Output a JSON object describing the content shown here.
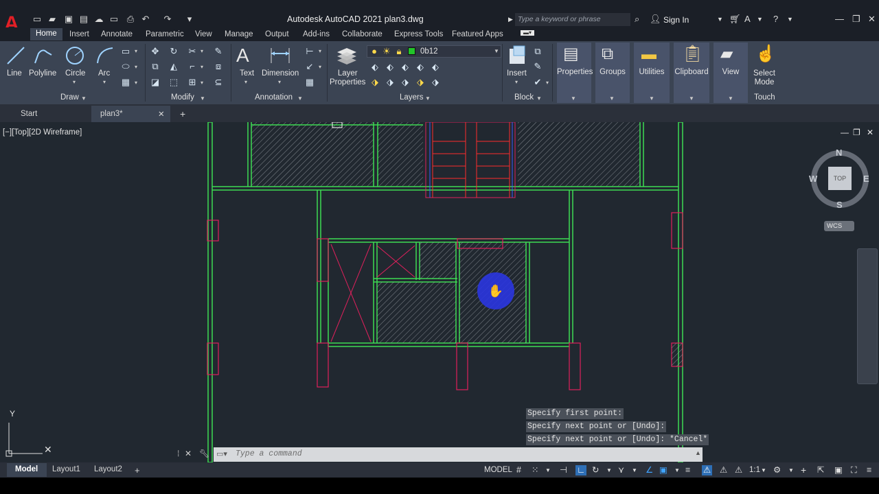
{
  "app": {
    "title": "Autodesk AutoCAD 2021   plan3.dwg",
    "logo": "A",
    "search_placeholder": "Type a keyword or phrase",
    "sign_in": "Sign In"
  },
  "ribbon_tabs": [
    "Home",
    "Insert",
    "Annotate",
    "Parametric",
    "View",
    "Manage",
    "Output",
    "Add-ins",
    "Collaborate",
    "Express Tools",
    "Featured Apps"
  ],
  "draw_panel": {
    "tools": [
      "Line",
      "Polyline",
      "Circle",
      "Arc"
    ],
    "label": "Draw"
  },
  "modify_panel": {
    "label": "Modify"
  },
  "annotation_panel": {
    "tools": [
      "Text",
      "Dimension"
    ],
    "label": "Annotation"
  },
  "layers_panel": {
    "layer_properties": "Layer\nProperties",
    "current_layer": "0b12",
    "label": "Layers",
    "layer_color": "#22c42a"
  },
  "block_panel": {
    "insert": "Insert",
    "label": "Block"
  },
  "groups": {
    "properties": "Properties",
    "groups": "Groups",
    "utilities": "Utilities",
    "clipboard": "Clipboard",
    "view": "View",
    "select_mode": "Select\nMode",
    "touch": "Touch"
  },
  "file_tabs": {
    "start": "Start",
    "active": "plan3*",
    "add": "+"
  },
  "viewport": {
    "label": "[−][Top][2D Wireframe]",
    "viewcube": {
      "top": "TOP",
      "n": "N",
      "s": "S",
      "e": "E",
      "w": "W",
      "wcs": "WCS"
    },
    "ucs_y": "Y"
  },
  "command": {
    "history": [
      "Specify first point:",
      "Specify next point or [Undo]:",
      "Specify next point or [Undo]: *Cancel*"
    ],
    "placeholder": "Type a command"
  },
  "layout_tabs": [
    "Model",
    "Layout1",
    "Layout2",
    "+"
  ],
  "status": {
    "model": "MODEL",
    "scale": "1:1"
  },
  "colors": {
    "wall": "#3ddc52",
    "column": "#e0205c",
    "stair": "#ff2d2d",
    "hatch": "#9aa0a6",
    "cursor": "#2a35e0"
  }
}
